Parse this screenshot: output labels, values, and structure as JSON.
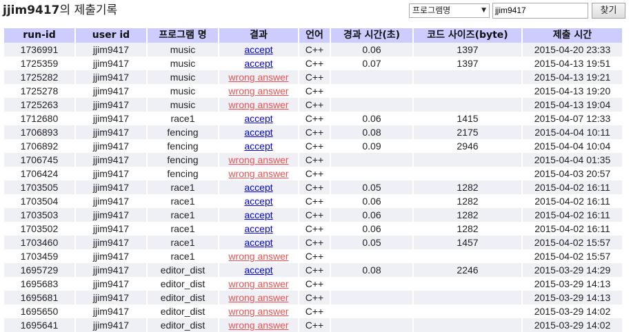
{
  "header": {
    "user_id": "jjim9417",
    "title_suffix": "의 제출기록",
    "filter_select_value": "프로그램명",
    "search_value": "jjim9417",
    "search_button_label": "찾기"
  },
  "table": {
    "columns": [
      "run-id",
      "user id",
      "프로그램 명",
      "결과",
      "언어",
      "경과 시간(초)",
      "코드 사이즈(byte)",
      "제출 시간"
    ],
    "rows": [
      {
        "run_id": "1736991",
        "user": "jjim9417",
        "program": "music",
        "result": "accept",
        "lang": "C++",
        "time": "0.06",
        "size": "1397",
        "submitted": "2015-04-20 23:33"
      },
      {
        "run_id": "1725359",
        "user": "jjim9417",
        "program": "music",
        "result": "accept",
        "lang": "C++",
        "time": "0.07",
        "size": "1397",
        "submitted": "2015-04-13 19:51"
      },
      {
        "run_id": "1725282",
        "user": "jjim9417",
        "program": "music",
        "result": "wrong answer",
        "lang": "C++",
        "time": "",
        "size": "",
        "submitted": "2015-04-13 19:21"
      },
      {
        "run_id": "1725278",
        "user": "jjim9417",
        "program": "music",
        "result": "wrong answer",
        "lang": "C++",
        "time": "",
        "size": "",
        "submitted": "2015-04-13 19:20"
      },
      {
        "run_id": "1725263",
        "user": "jjim9417",
        "program": "music",
        "result": "wrong answer",
        "lang": "C++",
        "time": "",
        "size": "",
        "submitted": "2015-04-13 19:04"
      },
      {
        "run_id": "1712680",
        "user": "jjim9417",
        "program": "race1",
        "result": "accept",
        "lang": "C++",
        "time": "0.06",
        "size": "1415",
        "submitted": "2015-04-07 12:33"
      },
      {
        "run_id": "1706893",
        "user": "jjim9417",
        "program": "fencing",
        "result": "accept",
        "lang": "C++",
        "time": "0.08",
        "size": "2175",
        "submitted": "2015-04-04 10:11"
      },
      {
        "run_id": "1706892",
        "user": "jjim9417",
        "program": "fencing",
        "result": "accept",
        "lang": "C++",
        "time": "0.09",
        "size": "2946",
        "submitted": "2015-04-04 10:04"
      },
      {
        "run_id": "1706745",
        "user": "jjim9417",
        "program": "fencing",
        "result": "wrong answer",
        "lang": "C++",
        "time": "",
        "size": "",
        "submitted": "2015-04-04 01:35"
      },
      {
        "run_id": "1706424",
        "user": "jjim9417",
        "program": "fencing",
        "result": "wrong answer",
        "lang": "C++",
        "time": "",
        "size": "",
        "submitted": "2015-04-03 20:57"
      },
      {
        "run_id": "1703505",
        "user": "jjim9417",
        "program": "race1",
        "result": "accept",
        "lang": "C++",
        "time": "0.05",
        "size": "1282",
        "submitted": "2015-04-02 16:11"
      },
      {
        "run_id": "1703504",
        "user": "jjim9417",
        "program": "race1",
        "result": "accept",
        "lang": "C++",
        "time": "0.06",
        "size": "1282",
        "submitted": "2015-04-02 16:11"
      },
      {
        "run_id": "1703503",
        "user": "jjim9417",
        "program": "race1",
        "result": "accept",
        "lang": "C++",
        "time": "0.06",
        "size": "1282",
        "submitted": "2015-04-02 16:11"
      },
      {
        "run_id": "1703502",
        "user": "jjim9417",
        "program": "race1",
        "result": "accept",
        "lang": "C++",
        "time": "0.06",
        "size": "1282",
        "submitted": "2015-04-02 16:11"
      },
      {
        "run_id": "1703460",
        "user": "jjim9417",
        "program": "race1",
        "result": "accept",
        "lang": "C++",
        "time": "0.05",
        "size": "1457",
        "submitted": "2015-04-02 15:57"
      },
      {
        "run_id": "1703459",
        "user": "jjim9417",
        "program": "race1",
        "result": "wrong answer",
        "lang": "C++",
        "time": "",
        "size": "",
        "submitted": "2015-04-02 15:57"
      },
      {
        "run_id": "1695729",
        "user": "jjim9417",
        "program": "editor_dist",
        "result": "accept",
        "lang": "C++",
        "time": "0.08",
        "size": "2246",
        "submitted": "2015-03-29 14:29"
      },
      {
        "run_id": "1695683",
        "user": "jjim9417",
        "program": "editor_dist",
        "result": "wrong answer",
        "lang": "C++",
        "time": "",
        "size": "",
        "submitted": "2015-03-29 14:13"
      },
      {
        "run_id": "1695681",
        "user": "jjim9417",
        "program": "editor_dist",
        "result": "wrong answer",
        "lang": "C++",
        "time": "",
        "size": "",
        "submitted": "2015-03-29 14:13"
      },
      {
        "run_id": "1695650",
        "user": "jjim9417",
        "program": "editor_dist",
        "result": "wrong answer",
        "lang": "C++",
        "time": "",
        "size": "",
        "submitted": "2015-03-29 14:02"
      },
      {
        "run_id": "1695641",
        "user": "jjim9417",
        "program": "editor_dist",
        "result": "wrong answer",
        "lang": "C++",
        "time": "",
        "size": "",
        "submitted": "2015-03-29 14:02"
      }
    ]
  },
  "colors": {
    "header_bg": "#ccccff",
    "row_alt_bg": "#eef0f6",
    "accept_link": "#0000ee",
    "wrong_link": "#f05050"
  }
}
